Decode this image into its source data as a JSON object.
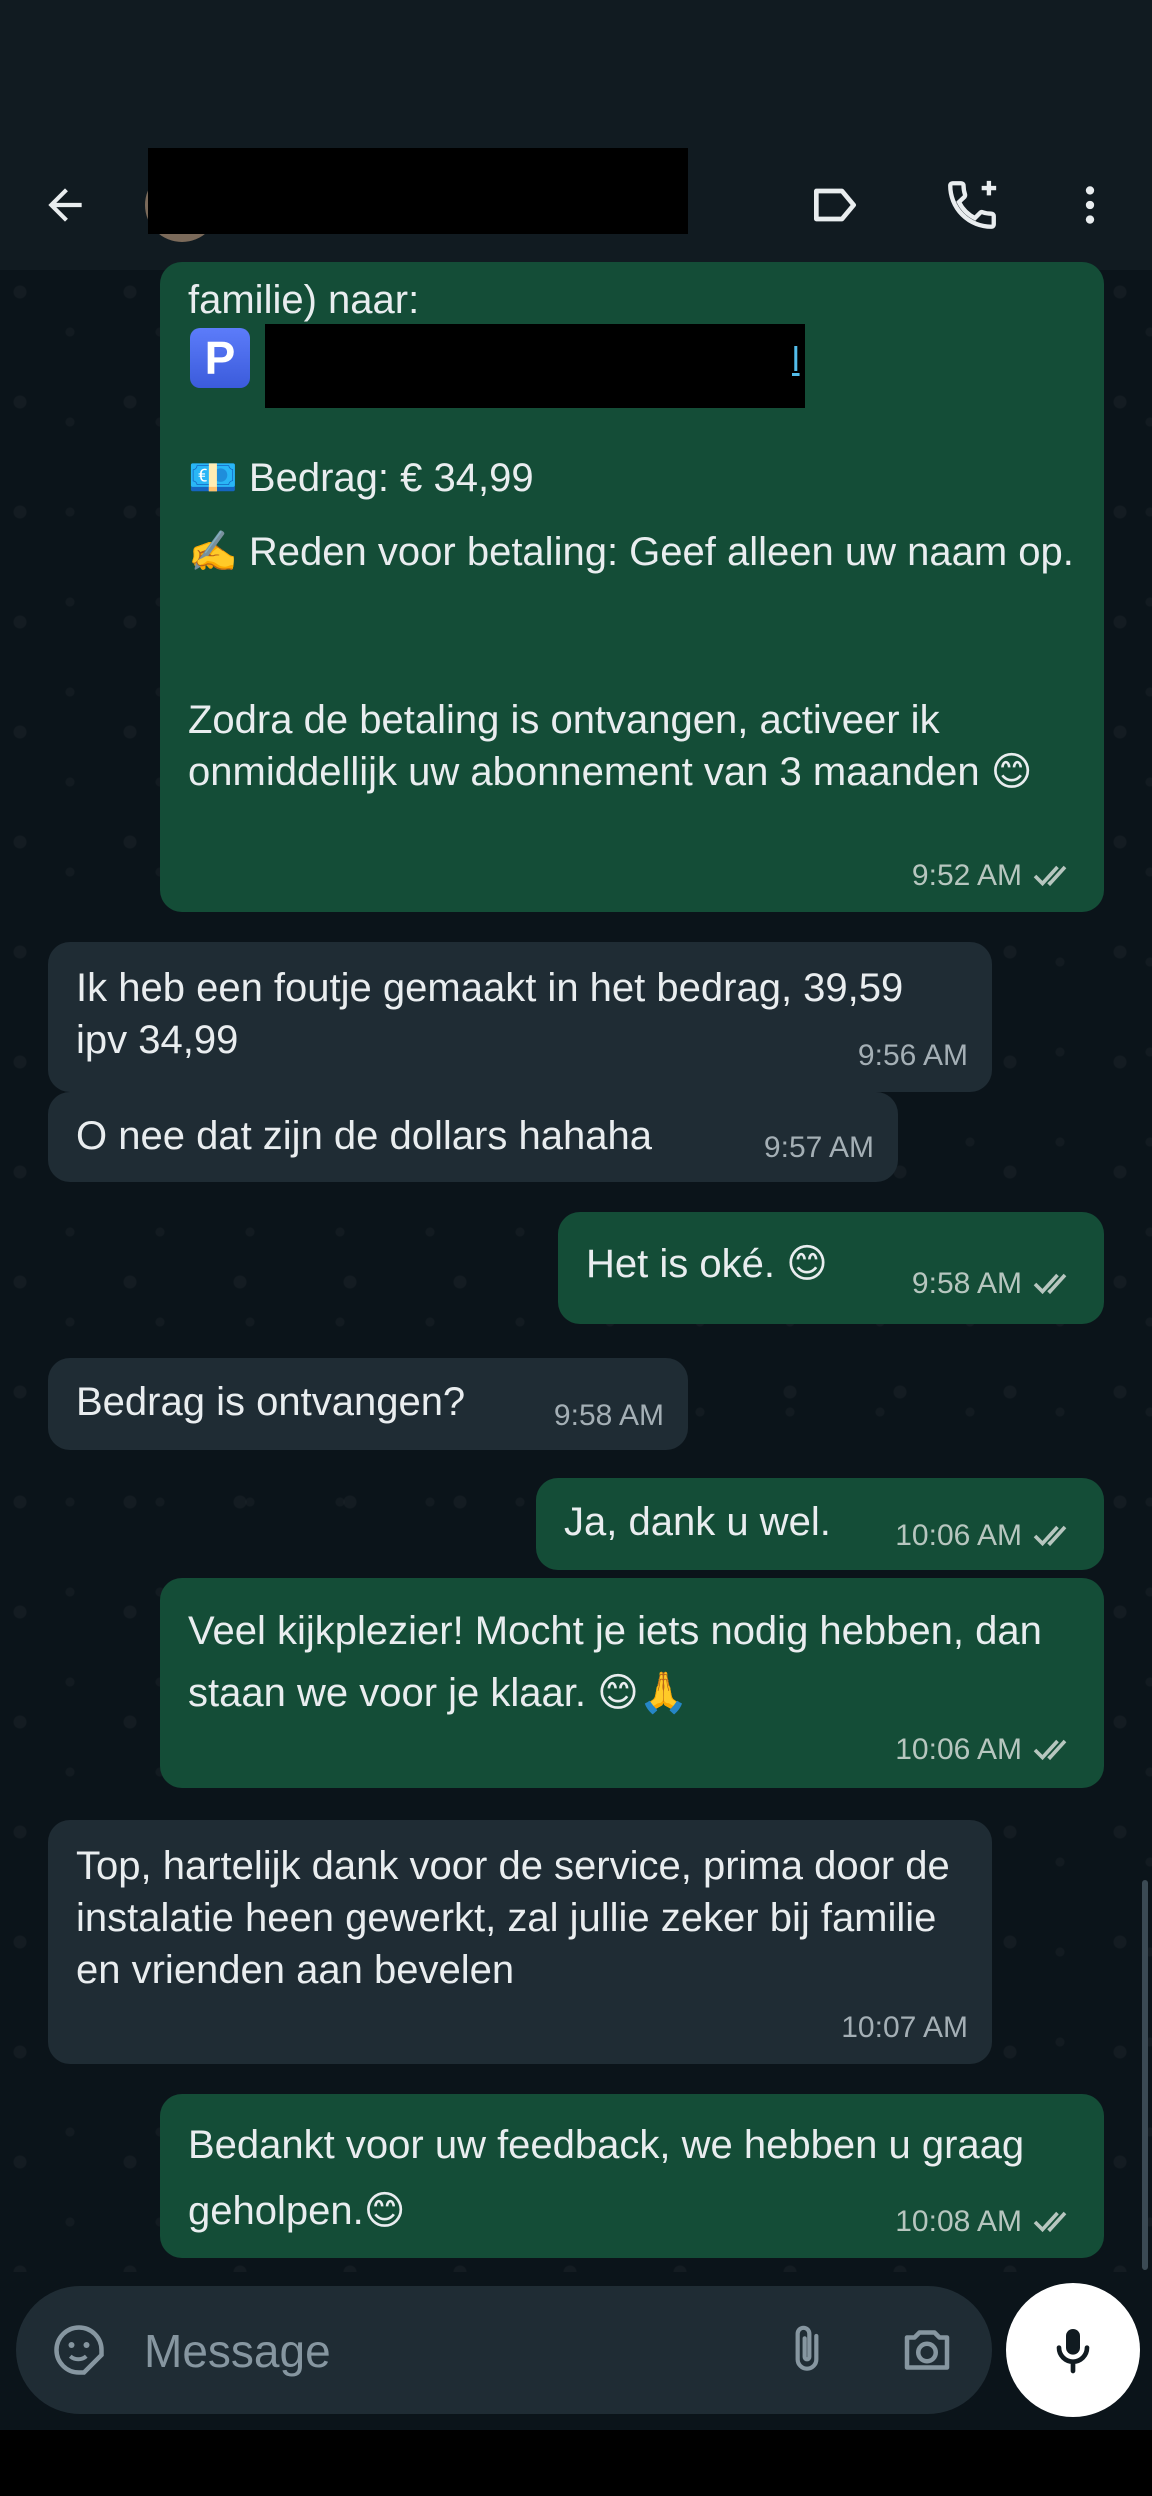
{
  "header": {
    "contact_name": "",
    "icons": [
      "back-arrow-icon",
      "label-icon",
      "add-call-icon",
      "more-vertical-icon"
    ]
  },
  "messages": {
    "m1": {
      "line1": "familie) naar:",
      "p_label": "P",
      "link_fragment": "l",
      "amount": "💶 Bedrag: € 34,99",
      "reason": "✍️ Reden voor betaling: Geef alleen uw naam op.",
      "activation": "Zodra de betaling is ontvangen, activeer ik onmiddellijk uw abonnement van 3 maanden 😊",
      "time": "9:52 AM"
    },
    "m2": {
      "text": "Ik heb een foutje gemaakt in het bedrag, 39,59 ipv 34,99",
      "time": "9:56 AM"
    },
    "m3": {
      "text": "O nee dat zijn de dollars hahaha",
      "time": "9:57 AM"
    },
    "m4": {
      "text": "Het is oké. 😊",
      "time": "9:58 AM"
    },
    "m5": {
      "text": "Bedrag is ontvangen?",
      "time": "9:58 AM"
    },
    "m6": {
      "text": "Ja, dank u wel.",
      "time": "10:06 AM"
    },
    "m7": {
      "text": "Veel kijkplezier! Mocht je iets nodig hebben, dan staan we voor je klaar. 😊🙏",
      "time": "10:06 AM"
    },
    "m8": {
      "text": "Top, hartelijk dank voor de service, prima door de instalatie heen gewerkt, zal jullie zeker bij familie en vrienden aan bevelen",
      "time": "10:07 AM"
    },
    "m9": {
      "text": "Bedankt voor uw feedback, we hebben u graag geholpen.😊",
      "time": "10:08 AM"
    }
  },
  "composer": {
    "placeholder": "Message",
    "icons": [
      "sticker-icon",
      "attach-icon",
      "camera-icon",
      "mic-icon"
    ]
  },
  "colors": {
    "outgoing_bubble": "#144d37",
    "incoming_bubble": "#1f2c34",
    "background": "#0b141a",
    "link": "#53bdeb"
  }
}
